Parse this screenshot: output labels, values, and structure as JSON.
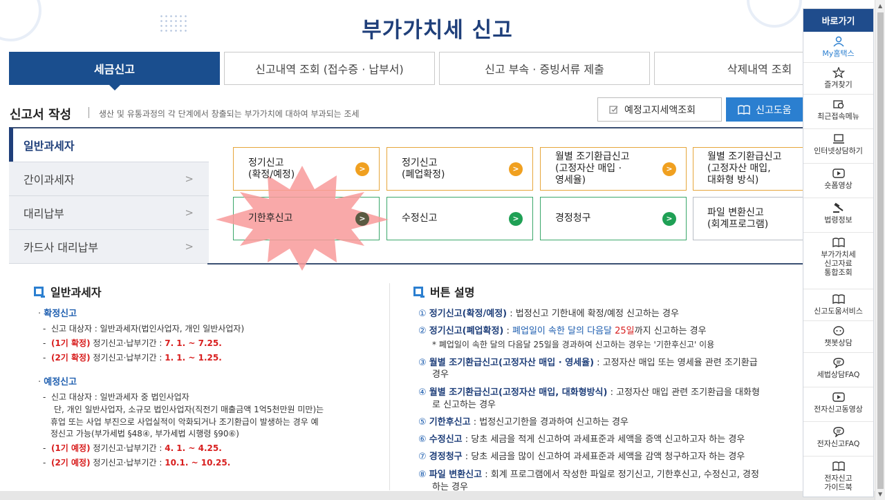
{
  "page_title": "부가가치세 신고",
  "tabs": [
    {
      "label": "세금신고",
      "active": true
    },
    {
      "label": "신고내역 조회 (접수증 · 납부서)",
      "active": false
    },
    {
      "label": "신고 부속 · 증빙서류 제출",
      "active": false
    },
    {
      "label": "삭제내역 조회",
      "active": false
    }
  ],
  "section": {
    "title": "신고서 작성",
    "desc": "생산 및 유통과정의 각 단계에서 창출되는 부가가치에 대하여 부과되는 조세"
  },
  "top_buttons": {
    "estimate": "예정고지세액조회",
    "help": "신고도움"
  },
  "side_nav": [
    {
      "label": "일반과세자",
      "active": true
    },
    {
      "label": "간이과세자"
    },
    {
      "label": "대리납부"
    },
    {
      "label": "카드사 대리납부"
    }
  ],
  "cards": [
    {
      "label": "정기신고\n(확정/예정)",
      "color": "orange"
    },
    {
      "label": "정기신고\n(폐업확정)",
      "color": "orange"
    },
    {
      "label": "월별 조기환급신고\n(고정자산 매입 ·\n영세율)",
      "color": "orange"
    },
    {
      "label": "월별 조기환급신고\n(고정자산 매입,\n대화형 방식)",
      "color": "orange"
    },
    {
      "label": "기한후신고",
      "color": "green",
      "highlighted": true
    },
    {
      "label": "수정신고",
      "color": "green"
    },
    {
      "label": "경정청구",
      "color": "green"
    },
    {
      "label": "파일 변환신고\n(회계프로그램)",
      "color": "gray"
    }
  ],
  "left_col": {
    "title": "일반과세자",
    "confirm_head": "확정신고",
    "confirm_target": "신고 대상자 : 일반과세자(법인사업자, 개인 일반사업자)",
    "confirm_p1_tag": "(1기 확정)",
    "confirm_p1_text": " 정기신고·납부기간 : ",
    "confirm_p1_date": "7. 1. ~ 7.25.",
    "confirm_p2_tag": "(2기 확정)",
    "confirm_p2_text": " 정기신고·납부기간 : ",
    "confirm_p2_date": "1. 1. ~ 1.25.",
    "prelim_head": "예정신고",
    "prelim_target1": "신고 대상자 : 일반과세자 중 법인사업자",
    "prelim_target2": "단, 개인 일반사업자, 소규모 법인사업자(직전기 매출금액 1억5천만원 미만)는",
    "prelim_target3": "휴업 또는 사업 부진으로 사업실적이 악화되거나 조기환급이 발생하는 경우 예",
    "prelim_target4": "정신고 가능(부가세법 §48④, 부가세법 시행령 §90⑥)",
    "prelim_p1_tag": "(1기 예정)",
    "prelim_p1_text": " 정기신고·납부기간 : ",
    "prelim_p1_date": "4. 1. ~ 4.25.",
    "prelim_p2_tag": "(2기 예정)",
    "prelim_p2_text": " 정기신고·납부기간 : ",
    "prelim_p2_date": "10.1. ~ 10.25."
  },
  "right_col": {
    "title": "버튼 설명",
    "items": [
      {
        "num": "①",
        "head": "정기신고(확정/예정)",
        "text": " : 법정신고 기한내에 확정/예정 신고하는 경우"
      },
      {
        "num": "②",
        "head": "정기신고(폐업확정)",
        "text_pre": " : ",
        "blue": "폐업일이 속한 달의 다음달 ",
        "red": "25일",
        "text": "까지 신고하는 경우"
      },
      {
        "num": "",
        "sub": "* 폐업일이 속한 달의 다음달 25일을 경과하여 신고하는 경우는 '기한후신고' 이용"
      },
      {
        "num": "③",
        "head": "월별 조기환급신고(고정자산 매입 · 영세율)",
        "text": " : 고정자산 매입 또는 영세율 관련 조기환급",
        "cont": "경우"
      },
      {
        "num": "④",
        "head": "월별 조기환급신고(고정자산 매입, 대화형방식)",
        "text": " : 고정자산 매입 관련 조기환급을 대화형",
        "cont": "로 신고하는 경우"
      },
      {
        "num": "⑤",
        "head": "기한후신고",
        "text": " : 법정신고기한을 경과하여 신고하는 경우"
      },
      {
        "num": "⑥",
        "head": "수정신고",
        "text": " : 당초 세금을 적게 신고하여 과세표준과 세액을 증액 신고하고자 하는 경우"
      },
      {
        "num": "⑦",
        "head": "경정청구",
        "text": " : 당초 세금을 많이 신고하여 과세표준과 세액을 감액 청구하고자 하는 경우"
      },
      {
        "num": "⑧",
        "head": "파일 변환신고",
        "text": " : 회계 프로그램에서 작성한 파일로 정기신고, 기한후신고, 수정신고, 경정",
        "cont": "하는 경우"
      }
    ]
  },
  "quickbar": {
    "title": "바로가기",
    "items": [
      {
        "label": "My홈택스",
        "icon": "person-icon"
      },
      {
        "label": "즐겨찾기",
        "icon": "star-icon"
      },
      {
        "label": "최근접속메뉴",
        "icon": "recent-menu-icon"
      },
      {
        "label": "인터넷상담하기",
        "icon": "laptop-chat-icon"
      },
      {
        "label": "숏폼영상",
        "icon": "play-icon"
      },
      {
        "label": "법령정보",
        "icon": "gavel-icon"
      },
      {
        "label": "부가가치세\n신고자료\n통합조회",
        "icon": "book-icon"
      },
      {
        "label": "신고도움서비스",
        "icon": "book-icon"
      },
      {
        "label": "챗봇상담",
        "icon": "chatbot-icon"
      },
      {
        "label": "세법상담FAQ",
        "icon": "chat-bubble-icon"
      },
      {
        "label": "전자신고동영상",
        "icon": "play-icon"
      },
      {
        "label": "전자신고FAQ",
        "icon": "chat-bubble-icon"
      },
      {
        "label": "전자신고\n가이드북",
        "icon": "book-icon"
      }
    ]
  },
  "colors": {
    "primary": "#1a4e8e",
    "accent_blue": "#2b7fd0",
    "orange": "#f0a020",
    "green": "#1fa055",
    "highlight_star": "#f89a9a",
    "red_text": "#d81e1e"
  }
}
